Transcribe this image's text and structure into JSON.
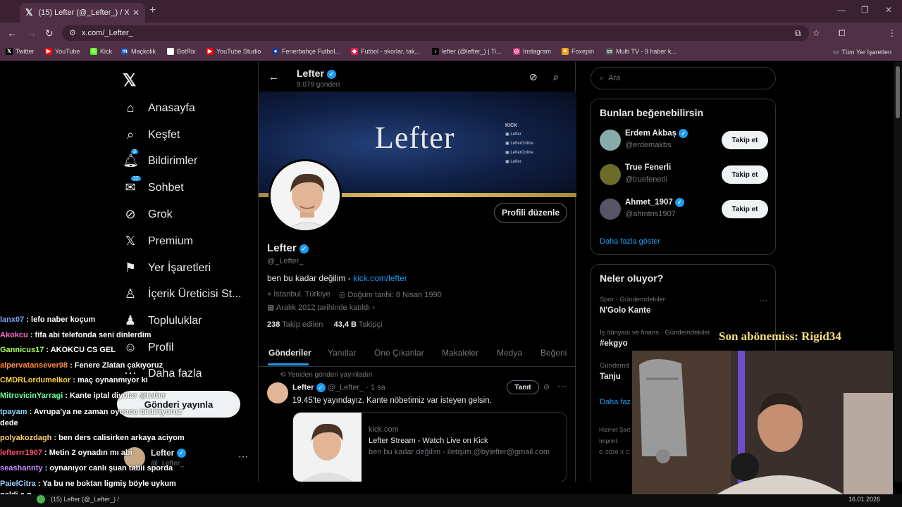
{
  "browser": {
    "tab_title": "(15) Lefter (@_Lefter_) / X",
    "url": "x.com/_Lefter_",
    "bookmarks": [
      {
        "label": "Twitter",
        "icon": "x-icon",
        "color": "#000000"
      },
      {
        "label": "YouTube",
        "icon": "youtube-icon",
        "color": "#ff0000"
      },
      {
        "label": "Kick",
        "icon": "kick-icon",
        "color": "#53fc18"
      },
      {
        "label": "Maçkolik",
        "icon": "mackolik-icon",
        "color": "#1e4ea1"
      },
      {
        "label": "BotRix",
        "icon": "botrix-icon",
        "color": "#ffffff"
      },
      {
        "label": "YouTube Studio",
        "icon": "youtube-studio-icon",
        "color": "#ff0000"
      },
      {
        "label": "Fenerbahçe Futbol...",
        "icon": "fenerbahce-icon",
        "color": "#1e3a8a"
      },
      {
        "label": "Futbol - skorlar, tak...",
        "icon": "flashscore-icon",
        "color": "#e11d48"
      },
      {
        "label": "lefter (@lefter_) | Ti...",
        "icon": "tiktok-icon",
        "color": "#000000"
      },
      {
        "label": "Instagram",
        "icon": "instagram-icon",
        "color": "#d62976"
      },
      {
        "label": "Foxepin",
        "icon": "foxepin-icon",
        "color": "#f59e0b"
      },
      {
        "label": "Multi TV - 9 haber k...",
        "icon": "multitv-icon",
        "color": "#555555"
      }
    ],
    "all_bookmarks": "Tüm Yer İşaretleri"
  },
  "nav": {
    "items": [
      {
        "label": "Anasayfa",
        "icon": "home-icon"
      },
      {
        "label": "Keşfet",
        "icon": "search-icon"
      },
      {
        "label": "Bildirimler",
        "icon": "bell-icon",
        "badge": "3"
      },
      {
        "label": "Sohbet",
        "icon": "mail-icon",
        "badge": "12"
      },
      {
        "label": "Grok",
        "icon": "grok-icon"
      },
      {
        "label": "Premium",
        "icon": "x-icon"
      },
      {
        "label": "Yer İşaretleri",
        "icon": "bookmark-icon"
      },
      {
        "label": "İçerik Üreticisi St...",
        "icon": "creator-studio-icon"
      },
      {
        "label": "Topluluklar",
        "icon": "communities-icon"
      },
      {
        "label": "Profil",
        "icon": "person-icon"
      },
      {
        "label": "Daha fazla",
        "icon": "more-icon"
      }
    ],
    "post_button": "Gönderi yayınla",
    "account": {
      "name": "Lefter",
      "handle": "@_Lefter_"
    }
  },
  "profile": {
    "name": "Lefter",
    "posts_count": "9.079 gönderi",
    "handle": "@_Lefter_",
    "bio": "ben bu kadar değilim -",
    "bio_link": "kick.com/lefter",
    "location": "İstanbul, Türkiye",
    "birthday": "Doğum tarihi: 8 Nisan 1990",
    "joined": "Aralık 2012 tarihinde katıldı",
    "following_count": "238",
    "following_label": "Takip edilen",
    "followers_count": "43,4 B",
    "followers_label": "Takipçi",
    "edit_button": "Profili düzenle",
    "banner_title": "Lefter",
    "banner_badge": "KICK",
    "banner_links": [
      "Lefter",
      "LefterOnline",
      "LefterOnline",
      "Lefter"
    ],
    "tabs": [
      "Gönderiler",
      "Yanıtlar",
      "Öne Çıkanlar",
      "Makaleler",
      "Medya",
      "Beğeni"
    ]
  },
  "post": {
    "repost_label": "Yeniden gönderi yayınladın",
    "name": "Lefter",
    "handle": "@_Lefter_",
    "time": "· 1 sa",
    "promote_button": "Tanıt",
    "text": "19.45'te yayındayız. Kante nöbetimiz var isteyen gelsin.",
    "card_domain": "kick.com",
    "card_title": "Lefter Stream - Watch Live on Kick",
    "card_desc": "ben bu kadar değilim - iletişim @bylefter@gmail.com"
  },
  "right": {
    "search_placeholder": "Ara",
    "who_to_follow_title": "Bunları beğenebilirsin",
    "suggestions": [
      {
        "name": "Erdem Akbaş",
        "handle": "@erdemakbs",
        "verified": true,
        "button": "Takip et"
      },
      {
        "name": "True Fenerli",
        "handle": "@truefenerli",
        "verified": false,
        "button": "Takip et"
      },
      {
        "name": "Ahmet_1907",
        "handle": "@ahmtns1907",
        "verified": true,
        "button": "Takip et"
      }
    ],
    "show_more": "Daha fazla göster",
    "trends_title": "Neler oluyor?",
    "trends": [
      {
        "context": "Spor · Gündemdekiler",
        "name": "N'Golo Kante"
      },
      {
        "context": "İş dünyası ve finans · Gündemdekiler",
        "name": "#ekgyo"
      },
      {
        "context": "Gündemd",
        "name": "Tanju"
      }
    ],
    "trends_more": "Daha faz",
    "footer": [
      "Hizmet Şart",
      "Imprint",
      "© 2026 X C"
    ]
  },
  "overlay": {
    "subscriber": "Son abönemiss: Rigid34",
    "chat": [
      {
        "user": "lanx07",
        "msg": "lefo naber koçum",
        "color": "#7aa7ff"
      },
      {
        "user": "Akokcu",
        "msg": "fifa abi telefonda seni dinlerdim",
        "color": "#ff6ad5"
      },
      {
        "user": "Gannicus17",
        "msg": "AKOKCU CS GEL",
        "color": "#a8ff60"
      },
      {
        "user": "alpervatansever98",
        "msg": "Fenere Zlatan çakıyoruz",
        "color": "#ff8c42"
      },
      {
        "user": "CMDRLordumelkor",
        "msg": "maç oynanmıyor ki",
        "color": "#ffd23f"
      },
      {
        "user": "MitrovicinYarragi",
        "msg": "Kante iptal diyolar @lefter",
        "color": "#6fff9e"
      },
      {
        "user": "tpayam",
        "msg": "Avrupa'ya ne zaman oyuncu bildiriyoruz dede",
        "color": "#8fd3ff"
      },
      {
        "user": "polyakozdagh",
        "msg": "ben ders calisirken arkaya aciyom",
        "color": "#ffcf6e"
      },
      {
        "user": "lefterrr1907",
        "msg": "Metin 2 oynadın mı abi",
        "color": "#ff4d6d"
      },
      {
        "user": "seashannty",
        "msg": "oynanıyor canlı şuan tabii sporda",
        "color": "#c58bff"
      },
      {
        "user": "PaielCitra",
        "msg": "Ya bu ne boktan ligmiş böyle uykum geldi a q",
        "color": "#9ad1ff"
      }
    ]
  },
  "taskbar": {
    "window_title": "(15) Lefter (@_Lefter_) /",
    "date": "16.01.2026"
  },
  "colors": {
    "accent": "#1d9bf0",
    "background": "#000000",
    "chrome": "#4f3046"
  }
}
